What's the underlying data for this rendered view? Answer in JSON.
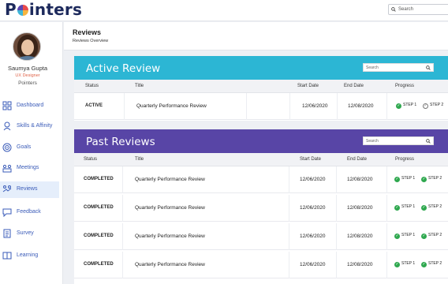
{
  "app": {
    "logo": "Pointers",
    "search_placeholder": "Search"
  },
  "user": {
    "name": "Saumya Gupta",
    "role": "UX Designer",
    "org": "Pointers"
  },
  "sidebar": {
    "items": [
      {
        "label": "Dashboard",
        "icon": "dashboard-icon",
        "active": false
      },
      {
        "label": "Skills & Affinity",
        "icon": "skills-icon",
        "active": false
      },
      {
        "label": "Goals",
        "icon": "goals-icon",
        "active": false
      },
      {
        "label": "Meetings",
        "icon": "meetings-icon",
        "active": false
      },
      {
        "label": "Reviews",
        "icon": "reviews-icon",
        "active": true
      },
      {
        "label": "Feedback",
        "icon": "feedback-icon",
        "active": false
      },
      {
        "label": "Survey",
        "icon": "survey-icon",
        "active": false
      },
      {
        "label": "Learning",
        "icon": "learning-icon",
        "active": false
      }
    ]
  },
  "page": {
    "title": "Reviews",
    "breadcrumb": "Reviews Overview"
  },
  "columns": {
    "status": "Status",
    "title": "Title",
    "start": "Start Date",
    "end": "End Date",
    "progress": "Progress"
  },
  "active_review": {
    "title": "Active Review",
    "color": "#2cb6d4",
    "search_placeholder": "Search",
    "rows": [
      {
        "status": "ACTIVE",
        "title": "Quarterly Performance Review",
        "start": "12/06/2020",
        "end": "12/08/2020",
        "step1": "STEP 1",
        "step2": "STEP 2"
      }
    ]
  },
  "past_reviews": {
    "title": "Past Reviews",
    "color": "#5845a6",
    "search_placeholder": "Search",
    "rows": [
      {
        "status": "COMPLETED",
        "title": "Quarterly Performance Review",
        "start": "12/06/2020",
        "end": "12/08/2020",
        "step1": "STEP 1",
        "step2": "STEP 2"
      },
      {
        "status": "COMPLETED",
        "title": "Quarterly Performance Review",
        "start": "12/06/2020",
        "end": "12/08/2020",
        "step1": "STEP 1",
        "step2": "STEP 2"
      },
      {
        "status": "COMPLETED",
        "title": "Quarterly Performance Review",
        "start": "12/06/2020",
        "end": "12/08/2020",
        "step1": "STEP 1",
        "step2": "STEP 2"
      },
      {
        "status": "COMPLETED",
        "title": "Quarterly Performance Review",
        "start": "12/06/2020",
        "end": "12/08/2020",
        "step1": "STEP 1",
        "step2": "STEP 2"
      }
    ]
  },
  "colors": {
    "nav_text": "#3a5bb8",
    "step_done": "#2fa84f"
  }
}
